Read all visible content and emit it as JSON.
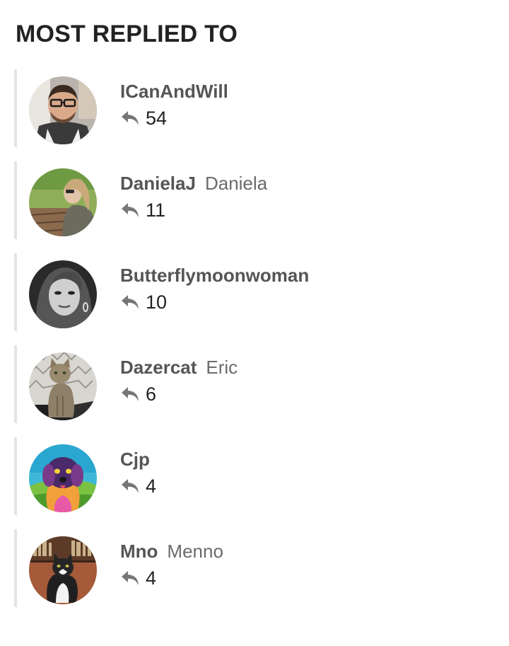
{
  "widget": {
    "title": "MOST REPLIED TO"
  },
  "users": [
    {
      "username": "ICanAndWill",
      "real_name": "",
      "reply_count": "54",
      "avatar": "man-glasses-avatar"
    },
    {
      "username": "DanielaJ",
      "real_name": "Daniela",
      "reply_count": "11",
      "avatar": "woman-outdoor-avatar"
    },
    {
      "username": "Butterflymoonwoman",
      "real_name": "",
      "reply_count": "10",
      "avatar": "woman-bw-portrait-avatar"
    },
    {
      "username": "Dazercat",
      "real_name": "Eric",
      "reply_count": "6",
      "avatar": "tabby-cat-avatar"
    },
    {
      "username": "Cjp",
      "real_name": "",
      "reply_count": "4",
      "avatar": "colorful-dog-avatar"
    },
    {
      "username": "Mno",
      "real_name": "Menno",
      "reply_count": "4",
      "avatar": "tuxedo-cat-avatar"
    }
  ],
  "icons": {
    "reply": "reply-arrow-icon"
  },
  "colors": {
    "username": "#555555",
    "real_name": "#6b6b6b",
    "count": "#222222",
    "icon": "#777777",
    "accent_bar": "#e4e4e4"
  }
}
